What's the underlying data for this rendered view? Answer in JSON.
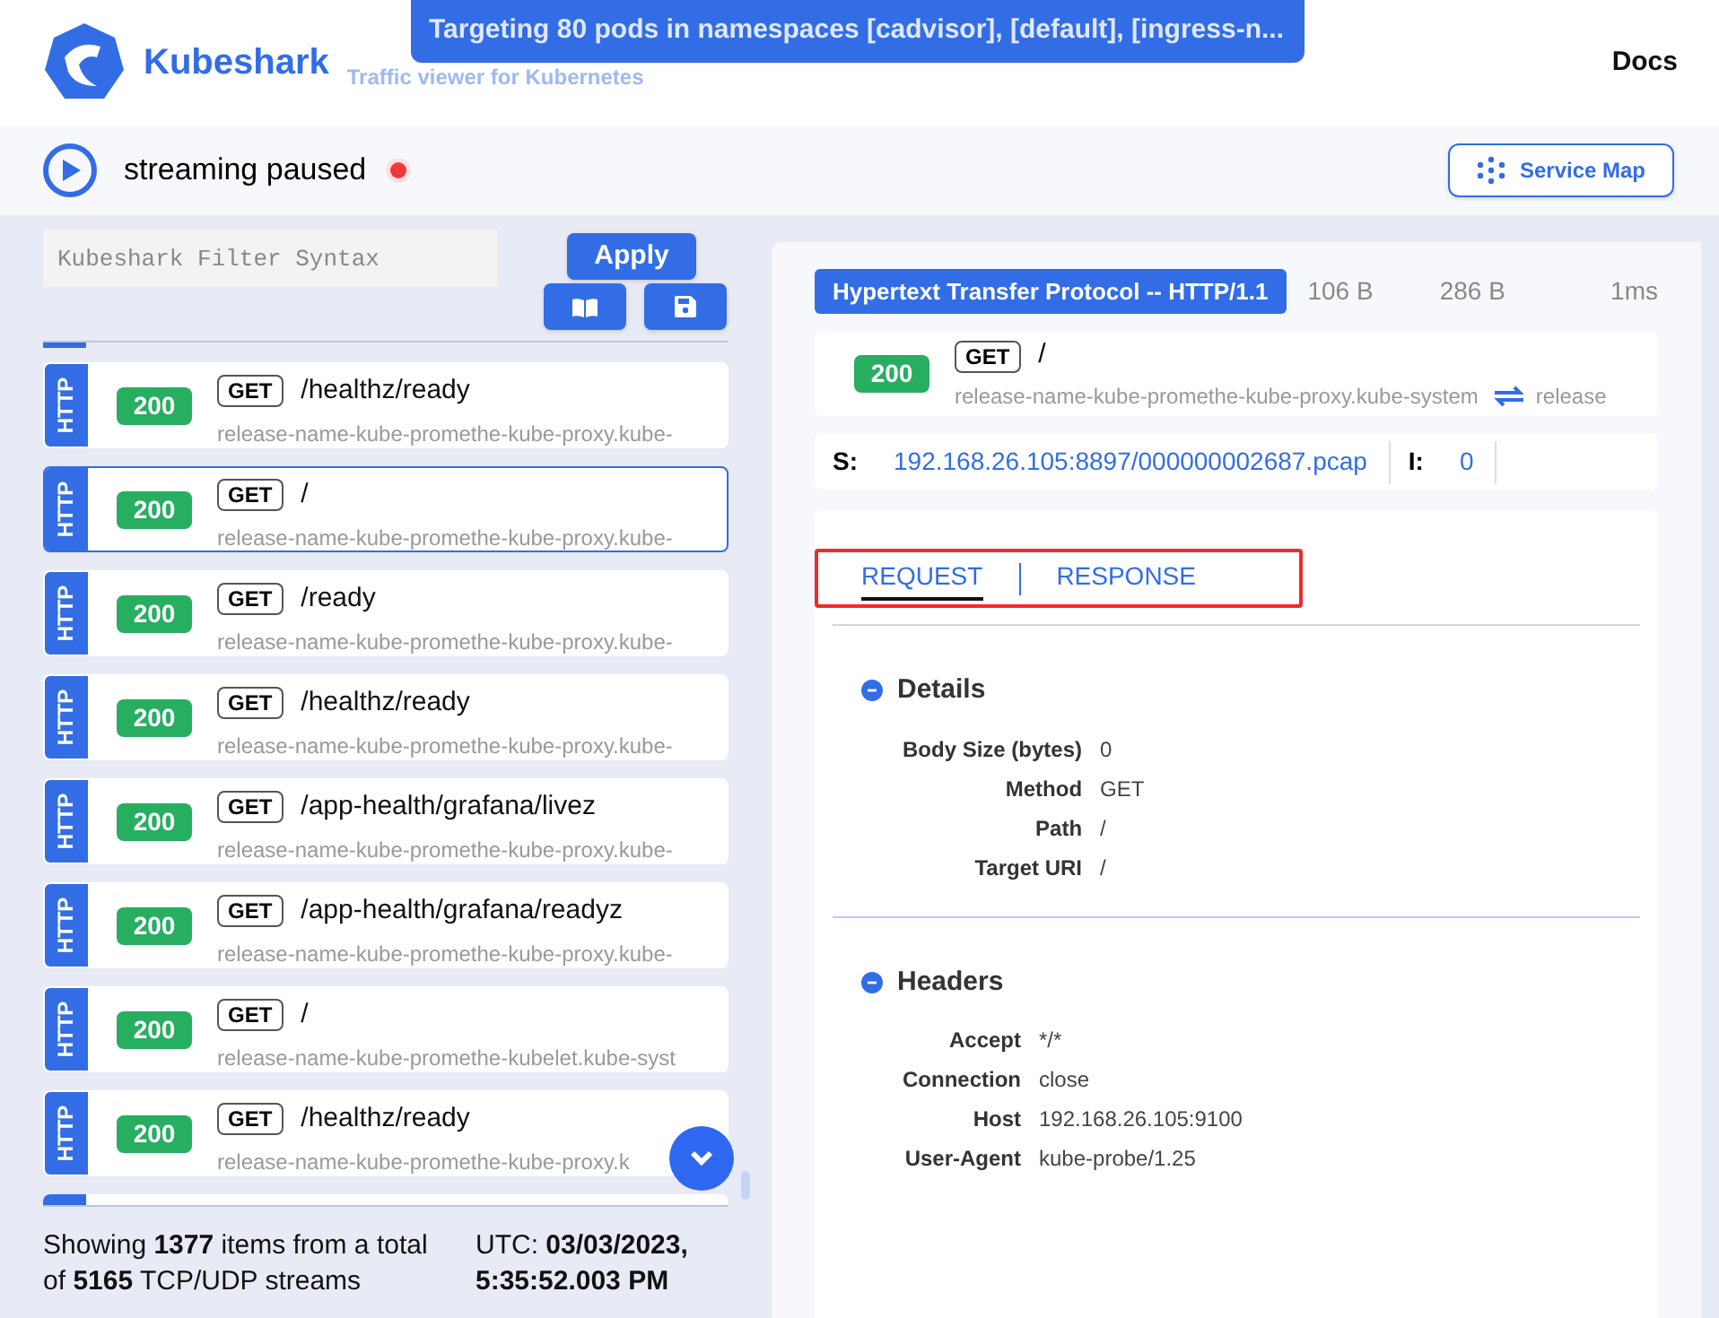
{
  "header": {
    "brand": "Kubeshark",
    "tagline": "Traffic viewer for Kubernetes",
    "toast": "Targeting 80 pods in namespaces [cadvisor], [default], [ingress-n...",
    "docs": "Docs"
  },
  "toolbar": {
    "status": "streaming paused",
    "recording": true,
    "service_map": "Service Map"
  },
  "filter": {
    "placeholder": "Kubeshark Filter Syntax",
    "apply": "Apply"
  },
  "entries": [
    {
      "protocol": "HTTP",
      "status": "200",
      "method": "GET",
      "path": "/healthz/ready",
      "source": "release-name-kube-promethe-kube-proxy.kube-",
      "selected": false
    },
    {
      "protocol": "HTTP",
      "status": "200",
      "method": "GET",
      "path": "/",
      "source": "release-name-kube-promethe-kube-proxy.kube-",
      "selected": true
    },
    {
      "protocol": "HTTP",
      "status": "200",
      "method": "GET",
      "path": "/ready",
      "source": "release-name-kube-promethe-kube-proxy.kube-",
      "selected": false
    },
    {
      "protocol": "HTTP",
      "status": "200",
      "method": "GET",
      "path": "/healthz/ready",
      "source": "release-name-kube-promethe-kube-proxy.kube-",
      "selected": false
    },
    {
      "protocol": "HTTP",
      "status": "200",
      "method": "GET",
      "path": "/app-health/grafana/livez",
      "source": "release-name-kube-promethe-kube-proxy.kube-",
      "selected": false
    },
    {
      "protocol": "HTTP",
      "status": "200",
      "method": "GET",
      "path": "/app-health/grafana/readyz",
      "source": "release-name-kube-promethe-kube-proxy.kube-",
      "selected": false
    },
    {
      "protocol": "HTTP",
      "status": "200",
      "method": "GET",
      "path": "/",
      "source": "release-name-kube-promethe-kubelet.kube-syst",
      "selected": false
    },
    {
      "protocol": "HTTP",
      "status": "200",
      "method": "GET",
      "path": "/healthz/ready",
      "source": "release-name-kube-promethe-kube-proxy.k",
      "selected": false
    }
  ],
  "footer": {
    "summary": "Showing **1377** items from a total of **5165** TCP/UDP streams",
    "time": "UTC: **03/03/2023, 5:35:52.003 PM**"
  },
  "detail": {
    "protocol": "Hypertext Transfer Protocol -- HTTP/1.1",
    "request_size": "106 B",
    "response_size": "286 B",
    "elapsed": "1ms",
    "status": "200",
    "method": "GET",
    "path": "/",
    "source": "release-name-kube-promethe-kube-proxy.kube-system",
    "destination": "release",
    "s_label": "S:",
    "s_value": "192.168.26.105:8897/000000002687.pcap",
    "i_label": "I:",
    "i_value": "0",
    "tabs": [
      {
        "label": "REQUEST",
        "selected": true
      },
      {
        "label": "RESPONSE",
        "selected": false
      }
    ],
    "sections": [
      {
        "title": "Details",
        "expanded": true,
        "rows": [
          {
            "key": "Body Size (bytes)",
            "value": "0"
          },
          {
            "key": "Method",
            "value": "GET"
          },
          {
            "key": "Path",
            "value": "/"
          },
          {
            "key": "Target URI",
            "value": "/"
          }
        ]
      },
      {
        "title": "Headers",
        "expanded": true,
        "rows": [
          {
            "key": "Accept",
            "value": "*/*"
          },
          {
            "key": "Connection",
            "value": "close"
          },
          {
            "key": "Host",
            "value": "192.168.26.105:9100"
          },
          {
            "key": "User-Agent",
            "value": "kube-probe/1.25"
          }
        ]
      }
    ]
  }
}
